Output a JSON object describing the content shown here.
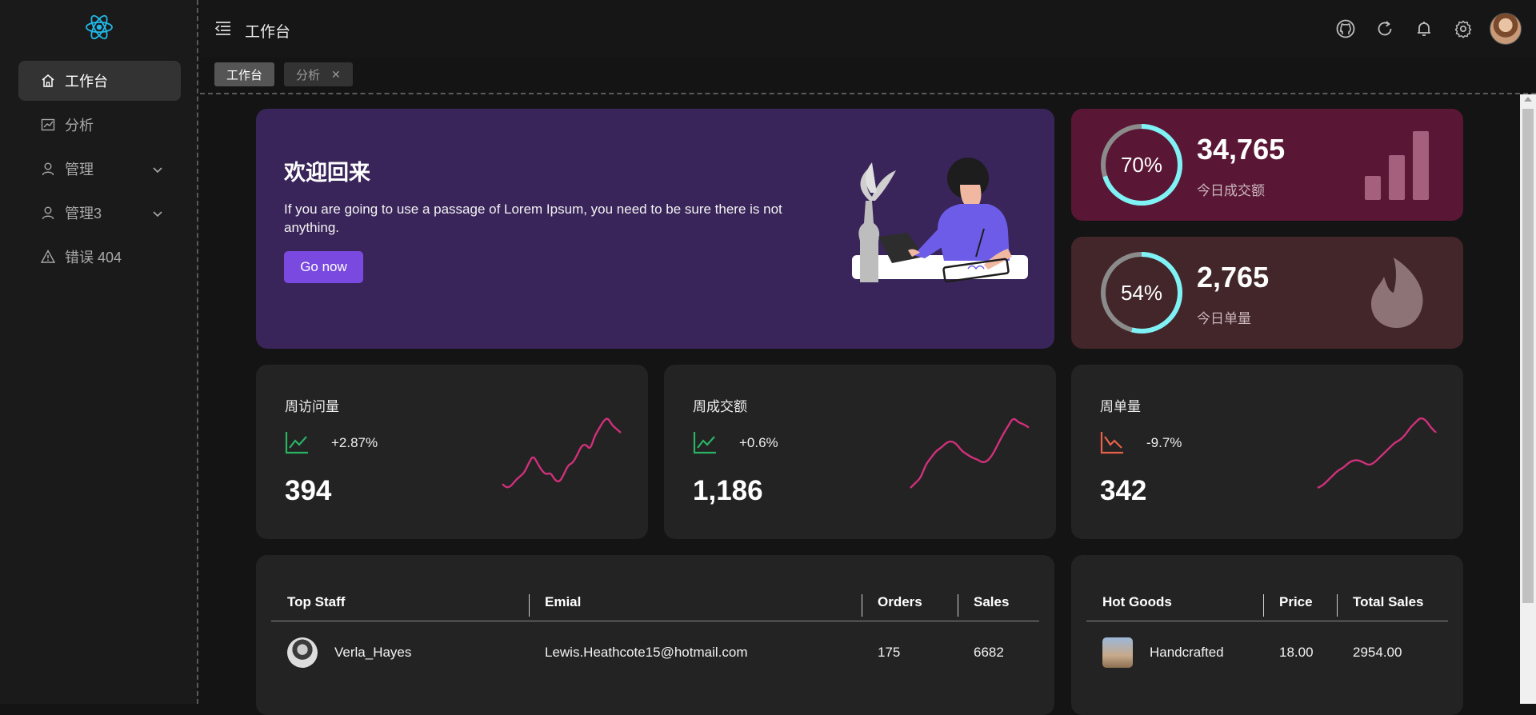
{
  "sidebar": {
    "logo": "react-icon",
    "items": [
      {
        "label": "工作台",
        "icon": "home-icon",
        "active": true
      },
      {
        "label": "分析",
        "icon": "chart-icon",
        "active": false
      },
      {
        "label": "管理",
        "icon": "user-icon",
        "active": false,
        "expandable": true
      },
      {
        "label": "管理3",
        "icon": "user-icon",
        "active": false,
        "expandable": true
      },
      {
        "label": "错误 404",
        "icon": "warning-icon",
        "active": false
      }
    ]
  },
  "header": {
    "title": "工作台",
    "icons": [
      "github-icon",
      "refresh-icon",
      "bell-icon",
      "gear-icon",
      "avatar"
    ]
  },
  "tabs": [
    {
      "label": "工作台",
      "active": true,
      "closable": false
    },
    {
      "label": "分析",
      "active": false,
      "closable": true,
      "close_glyph": "✕"
    }
  ],
  "welcome": {
    "title": "欢迎回来",
    "text": "If you are going to use a passage of Lorem Ipsum, you need to be sure there is not anything.",
    "button": "Go now"
  },
  "stats": [
    {
      "percent": 70,
      "percent_label": "70%",
      "value": "34,765",
      "label": "今日成交额",
      "icon": "bar-chart-icon",
      "bg": "#5a1735"
    },
    {
      "percent": 54,
      "percent_label": "54%",
      "value": "2,765",
      "label": "今日单量",
      "icon": "flame-icon",
      "bg": "#422629"
    }
  ],
  "weekly": [
    {
      "title": "周访问量",
      "change": "+2.87%",
      "trend": "up",
      "value": "394",
      "spark": [
        3,
        1,
        2,
        5,
        7,
        9,
        14,
        18,
        14,
        10,
        8,
        9,
        5,
        4,
        8,
        13,
        14,
        18,
        23,
        24,
        21,
        28,
        32,
        36,
        38,
        34,
        32,
        30
      ]
    },
    {
      "title": "周成交额",
      "change": "+0.6%",
      "trend": "up",
      "value": "1,186",
      "spark": [
        2,
        5,
        8,
        16,
        20,
        24,
        26,
        29,
        30,
        28,
        24,
        22,
        20,
        19,
        17,
        18,
        22,
        28,
        34,
        39,
        44,
        41,
        40,
        38
      ]
    },
    {
      "title": "周单量",
      "change": "-9.7%",
      "trend": "down",
      "value": "342",
      "spark": [
        2,
        3,
        5,
        7,
        9,
        10,
        12,
        13,
        13,
        12,
        11,
        12,
        14,
        16,
        18,
        20,
        21,
        23,
        26,
        28,
        30,
        29,
        26,
        24
      ]
    }
  ],
  "staff_table": {
    "headers": [
      "Top Staff",
      "Emial",
      "Orders",
      "Sales"
    ],
    "rows": [
      {
        "name": "Verla_Hayes",
        "email": "Lewis.Heathcote15@hotmail.com",
        "orders": "175",
        "sales": "6682"
      }
    ]
  },
  "goods_table": {
    "headers": [
      "Hot Goods",
      "Price",
      "Total Sales"
    ],
    "rows": [
      {
        "name": "Handcrafted",
        "price": "18.00",
        "total": "2954.00"
      }
    ]
  },
  "colors": {
    "ring": "#7ff2f6",
    "ring_track": "#8b8b8b",
    "spark": "#d0307a",
    "trend_up": "#28b463",
    "trend_down": "#e8604a",
    "welcome_bg": "#39255a",
    "button": "#7a4ae0"
  }
}
